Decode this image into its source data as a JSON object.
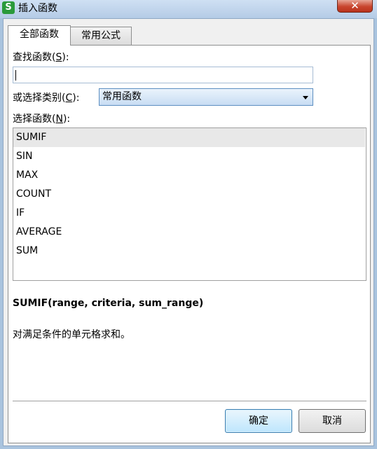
{
  "window": {
    "app_icon_letter": "S",
    "title": "插入函数",
    "close_glyph": "✕"
  },
  "tabs": [
    {
      "label": "全部函数",
      "active": true
    },
    {
      "label": "常用公式",
      "active": false
    }
  ],
  "search": {
    "label_prefix": "查找函数(",
    "label_key": "S",
    "label_suffix": "):",
    "value": ""
  },
  "category": {
    "label_prefix": "或选择类别(",
    "label_key": "C",
    "label_suffix": "):",
    "selected": "常用函数"
  },
  "function_list": {
    "label_prefix": "选择函数(",
    "label_key": "N",
    "label_suffix": "):",
    "items": [
      "SUMIF",
      "SIN",
      "MAX",
      "COUNT",
      "IF",
      "AVERAGE",
      "SUM"
    ],
    "selected_index": 0
  },
  "details": {
    "signature": "SUMIF(range, criteria, sum_range)",
    "description": "对满足条件的单元格求和。"
  },
  "buttons": {
    "ok": "确定",
    "cancel": "取消"
  }
}
